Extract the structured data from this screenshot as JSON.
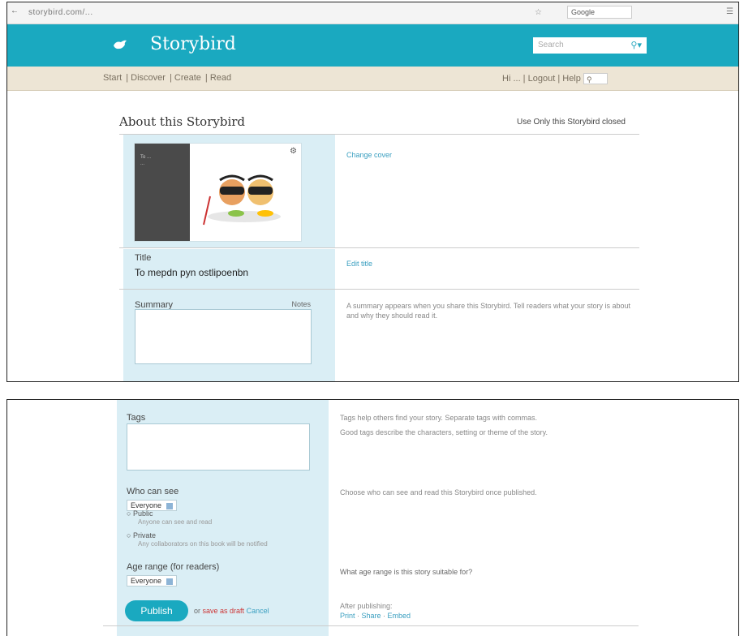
{
  "browser": {
    "url": "storybird.com/...",
    "search_placeholder": "Google",
    "right_status": "☆"
  },
  "header": {
    "logo": "Storybird",
    "search_placeholder": "Search"
  },
  "nav": {
    "links": [
      "Start",
      "Discover",
      "Create",
      "Read"
    ],
    "right": [
      "Hi",
      "...",
      "Logout",
      "Help"
    ]
  },
  "page": {
    "title": "About this Storybird",
    "view_info": "Use Only this Storybird closed"
  },
  "cover": {
    "title_line1": "To ...",
    "title_line2": "...",
    "link": "Change cover"
  },
  "title_section": {
    "label": "Title",
    "value": "To mepdn pyn ostlipoenbn",
    "link": "Edit title"
  },
  "summary": {
    "label": "Summary",
    "note": "Notes",
    "help": "A summary appears when you share this Storybird. Tell readers what your story is about and why they should read it."
  },
  "tags": {
    "label": "Tags",
    "help1": "Tags help others find your story. Separate tags with commas.",
    "help2": "Good tags describe the characters, setting or theme of the story."
  },
  "privacy": {
    "label": "Who can see",
    "selected": "Everyone",
    "help": "Choose who can see and read this Storybird once published.",
    "option1_label": "Public",
    "option1_sub": "Anyone can see and read",
    "option2_label": "Private",
    "option2_sub": "Any collaborators on this book will be notified"
  },
  "age": {
    "label": "Age range (for readers)",
    "selected": "Everyone",
    "help": "What age range is this story suitable for?"
  },
  "publish": {
    "button": "Publish",
    "or": "or",
    "save_link": "save as draft",
    "cancel_link": "Cancel",
    "after_label": "After publishing:",
    "after_links": [
      "Print",
      "Share",
      "Embed"
    ]
  },
  "colors": {
    "header": "#1aa9c0",
    "nav": "#ede5d5",
    "panel": "#daeef5"
  }
}
